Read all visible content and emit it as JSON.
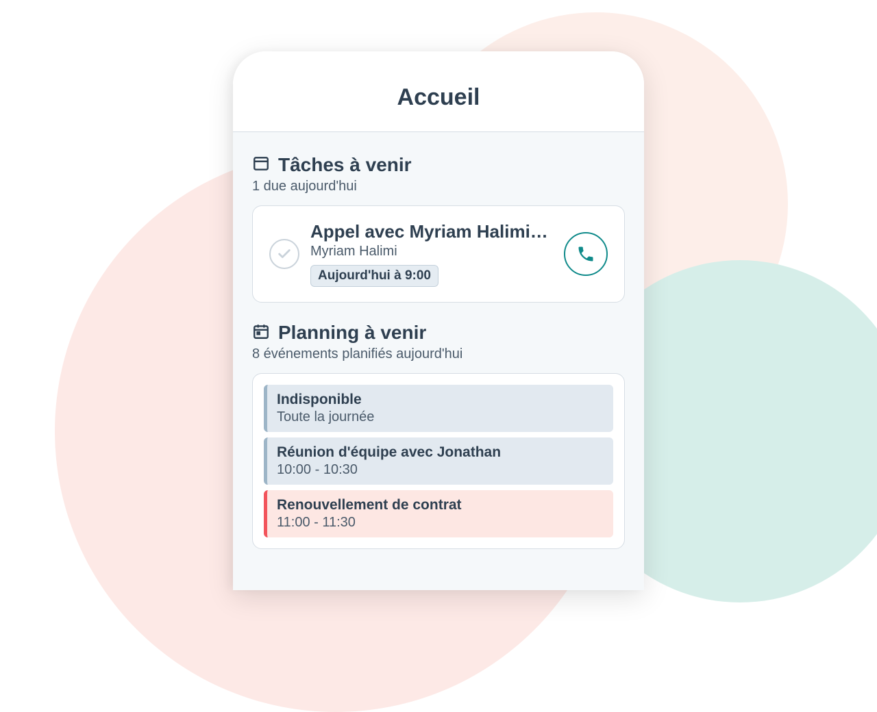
{
  "header": {
    "title": "Accueil"
  },
  "tasks": {
    "icon": "tasks-icon",
    "title": "Tâches à venir",
    "subtitle": "1 due aujourd'hui",
    "item": {
      "title": "Appel avec Myriam Halimi…",
      "contact": "Myriam Halimi",
      "due": "Aujourd'hui à 9:00"
    }
  },
  "planning": {
    "icon": "calendar-icon",
    "title": "Planning à venir",
    "subtitle": "8 événements planifiés aujourd'hui",
    "events": [
      {
        "title": "Indisponible",
        "time": "Toute la journée",
        "color": "blue"
      },
      {
        "title": "Réunion d'équipe avec Jonathan",
        "time": "10:00 - 10:30",
        "color": "blue"
      },
      {
        "title": "Renouvellement de contrat",
        "time": "11:00 - 11:30",
        "color": "red"
      }
    ]
  },
  "colors": {
    "accent_teal": "#0f8a8a",
    "text_dark": "#2e3f50",
    "bg_pink": "#fde9e6",
    "bg_teal": "#d6eee9"
  }
}
